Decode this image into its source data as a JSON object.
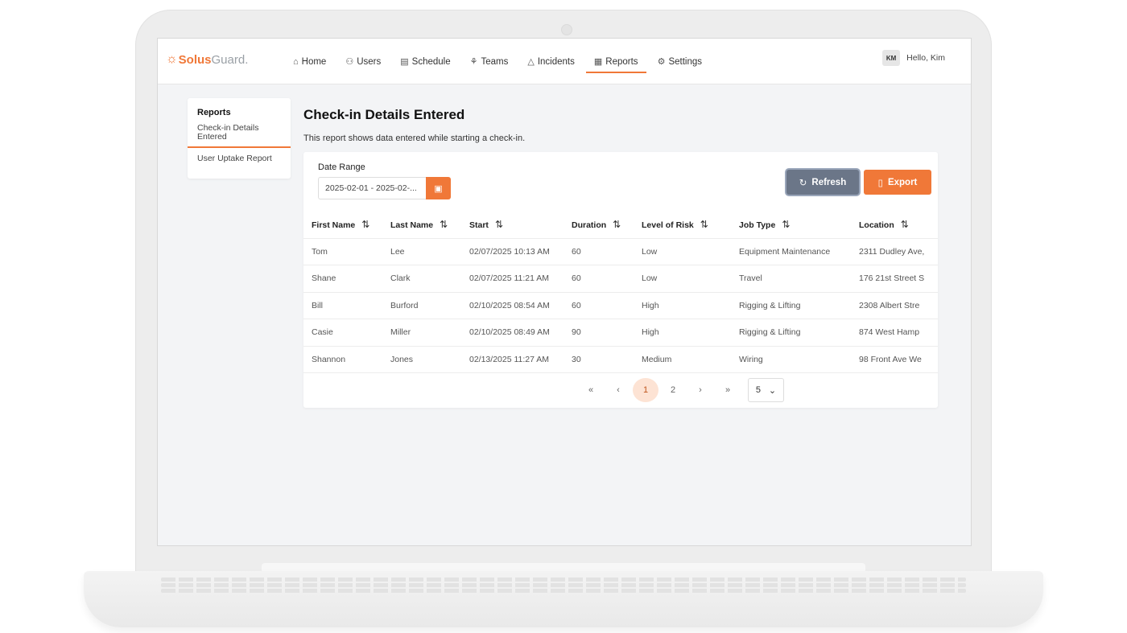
{
  "brand": {
    "name_a": "Solus",
    "name_b": "Guard."
  },
  "nav": [
    {
      "label": "Home",
      "icon": "home-icon"
    },
    {
      "label": "Users",
      "icon": "users-icon"
    },
    {
      "label": "Schedule",
      "icon": "calendar-icon"
    },
    {
      "label": "Teams",
      "icon": "teams-icon"
    },
    {
      "label": "Incidents",
      "icon": "warning-icon"
    },
    {
      "label": "Reports",
      "icon": "report-icon",
      "active": true
    },
    {
      "label": "Settings",
      "icon": "gear-icon"
    }
  ],
  "user": {
    "initials": "KM",
    "greeting": "Hello, Kim"
  },
  "sidebar": {
    "title": "Reports",
    "items": [
      "Check-in Details Entered",
      "User Uptake Report"
    ]
  },
  "page": {
    "title": "Check-in Details Entered",
    "description": "This report shows data entered while starting a check-in."
  },
  "filters": {
    "date_range_label": "Date Range",
    "date_range_value": "2025-02-01 - 2025-02-..."
  },
  "actions": {
    "refresh": "Refresh",
    "export": "Export"
  },
  "table": {
    "columns": [
      "First Name",
      "Last Name",
      "Start",
      "Duration",
      "Level of Risk",
      "Job Type",
      "Location"
    ],
    "rows": [
      [
        "Tom",
        "Lee",
        "02/07/2025 10:13 AM",
        "60",
        "Low",
        "Equipment Maintenance",
        "2311 Dudley Ave,"
      ],
      [
        "Shane",
        "Clark",
        "02/07/2025 11:21 AM",
        "60",
        "Low",
        "Travel",
        "176 21st Street S"
      ],
      [
        "Bill",
        "Burford",
        "02/10/2025 08:54 AM",
        "60",
        "High",
        "Rigging & Lifting",
        "2308 Albert Stre"
      ],
      [
        "Casie",
        "Miller",
        "02/10/2025 08:49 AM",
        "90",
        "High",
        "Rigging & Lifting",
        "874 West Hamp"
      ],
      [
        "Shannon",
        "Jones",
        "02/13/2025 11:27 AM",
        "30",
        "Medium",
        "Wiring",
        "98 Front Ave We"
      ]
    ]
  },
  "pagination": {
    "first": "«",
    "prev": "‹",
    "pages": [
      "1",
      "2"
    ],
    "current": "1",
    "next": "›",
    "last": "»",
    "page_size": "5"
  },
  "colors": {
    "accent": "#f07838",
    "refresh": "#6b7688"
  }
}
